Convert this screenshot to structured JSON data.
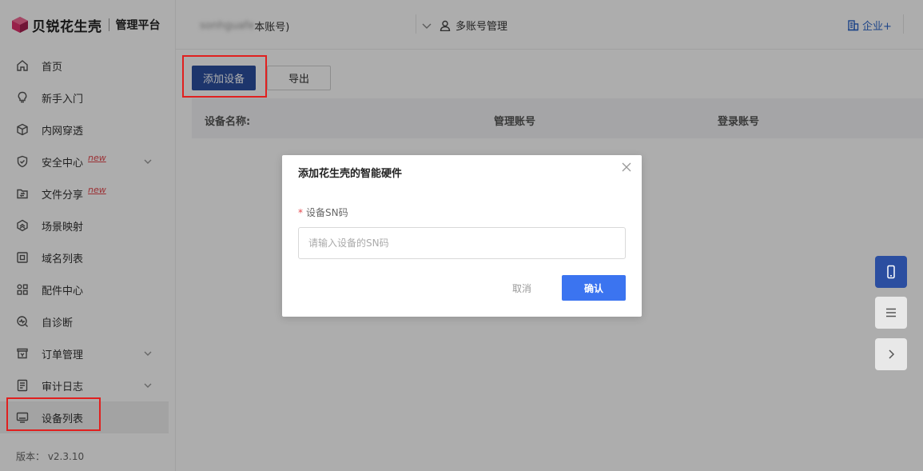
{
  "brand": {
    "name": "贝锐花生壳",
    "sub": "管理平台",
    "logo_color": "#e0326e"
  },
  "sidebar": {
    "items": [
      {
        "label": "首页",
        "icon": "home-icon",
        "badge": "",
        "expandable": false
      },
      {
        "label": "新手入门",
        "icon": "bulb-icon",
        "badge": "",
        "expandable": false
      },
      {
        "label": "内网穿透",
        "icon": "cube-icon",
        "badge": "",
        "expandable": false
      },
      {
        "label": "安全中心",
        "icon": "shield-icon",
        "badge": "new",
        "expandable": true
      },
      {
        "label": "文件分享",
        "icon": "folder-share-icon",
        "badge": "new",
        "expandable": false
      },
      {
        "label": "场景映射",
        "icon": "scene-icon",
        "badge": "",
        "expandable": false
      },
      {
        "label": "域名列表",
        "icon": "domain-icon",
        "badge": "",
        "expandable": false
      },
      {
        "label": "配件中心",
        "icon": "apps-icon",
        "badge": "",
        "expandable": false
      },
      {
        "label": "自诊断",
        "icon": "diagnose-icon",
        "badge": "",
        "expandable": false
      },
      {
        "label": "订单管理",
        "icon": "order-icon",
        "badge": "",
        "expandable": true
      },
      {
        "label": "审计日志",
        "icon": "log-icon",
        "badge": "",
        "expandable": true
      },
      {
        "label": "设备列表",
        "icon": "monitor-icon",
        "badge": "",
        "expandable": false,
        "active": true
      }
    ],
    "version": "版本：  v2.3.10"
  },
  "topbar": {
    "account_blurred": "sonhguafe",
    "account_suffix": "本账号)",
    "multi_account": "多账号管理",
    "enterprise": "企业+"
  },
  "toolbar": {
    "add_label": "添加设备",
    "export_label": "导出"
  },
  "table": {
    "headers": [
      "设备名称:",
      "管理账号",
      "登录账号"
    ]
  },
  "modal": {
    "title": "添加花生壳的智能硬件",
    "required_mark": "*",
    "field_label": "设备SN码",
    "placeholder": "请输入设备的SN码",
    "value": "",
    "cancel_label": "取消",
    "ok_label": "确认"
  },
  "colors": {
    "primary": "#2b4ea0",
    "confirm": "#3b74f0",
    "highlight": "#e0201f",
    "new_badge": "#e5484d"
  }
}
